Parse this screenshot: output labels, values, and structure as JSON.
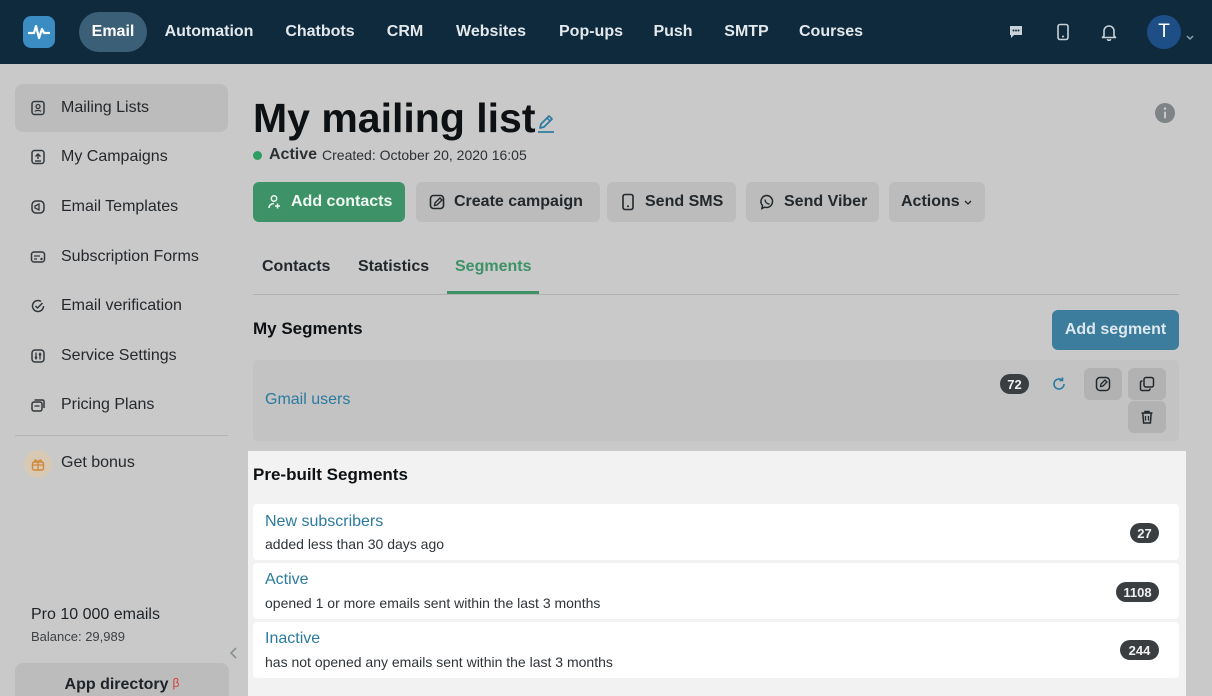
{
  "nav": {
    "items": [
      {
        "label": "Email",
        "active": true
      },
      {
        "label": "Automation"
      },
      {
        "label": "Chatbots"
      },
      {
        "label": "CRM"
      },
      {
        "label": "Websites"
      },
      {
        "label": "Pop-ups"
      },
      {
        "label": "Push"
      },
      {
        "label": "SMTP"
      },
      {
        "label": "Courses"
      }
    ],
    "icons": [
      "chat-icon",
      "phone-icon",
      "bell-icon"
    ],
    "avatar_initial": "T"
  },
  "sidebar": {
    "items": [
      {
        "label": "Mailing Lists",
        "icon": "contacts-icon",
        "active": true
      },
      {
        "label": "My Campaigns",
        "icon": "campaign-icon"
      },
      {
        "label": "Email Templates",
        "icon": "templates-icon"
      },
      {
        "label": "Subscription Forms",
        "icon": "forms-icon"
      },
      {
        "label": "Email verification",
        "icon": "check-circle-icon"
      },
      {
        "label": "Service Settings",
        "icon": "settings-icon"
      },
      {
        "label": "Pricing Plans",
        "icon": "pricing-icon"
      }
    ],
    "bonus_label": "Get bonus",
    "plan_name": "Pro 10 000 emails",
    "balance": "Balance: 29,989",
    "app_directory": "App directory",
    "beta_mark": "β"
  },
  "page": {
    "title": "My mailing list",
    "status": "Active",
    "created": "Created: October 20, 2020 16:05"
  },
  "actions": {
    "add_contacts": "Add contacts",
    "create_campaign": "Create campaign",
    "send_sms": "Send SMS",
    "send_viber": "Send Viber",
    "more": "Actions"
  },
  "tabs": [
    {
      "label": "Contacts"
    },
    {
      "label": "Statistics"
    },
    {
      "label": "Segments",
      "active": true
    }
  ],
  "my_segments": {
    "title": "My Segments",
    "add_label": "Add segment",
    "items": [
      {
        "name": "Gmail users",
        "count": "72"
      }
    ]
  },
  "prebuilt": {
    "title": "Pre-built Segments",
    "items": [
      {
        "name": "New subscribers",
        "desc": "added less than 30 days ago",
        "count": "27"
      },
      {
        "name": "Active",
        "desc": "opened 1 or more emails sent within the last 3 months",
        "count": "1108"
      },
      {
        "name": "Inactive",
        "desc": "has not opened any emails sent within the last 3 months",
        "count": "244"
      }
    ]
  },
  "colors": {
    "nav_bg": "#0f2a3c",
    "accent_green": "#3d9268",
    "link_blue": "#2b7aa0",
    "add_segment_bg": "#3c7c9c"
  }
}
